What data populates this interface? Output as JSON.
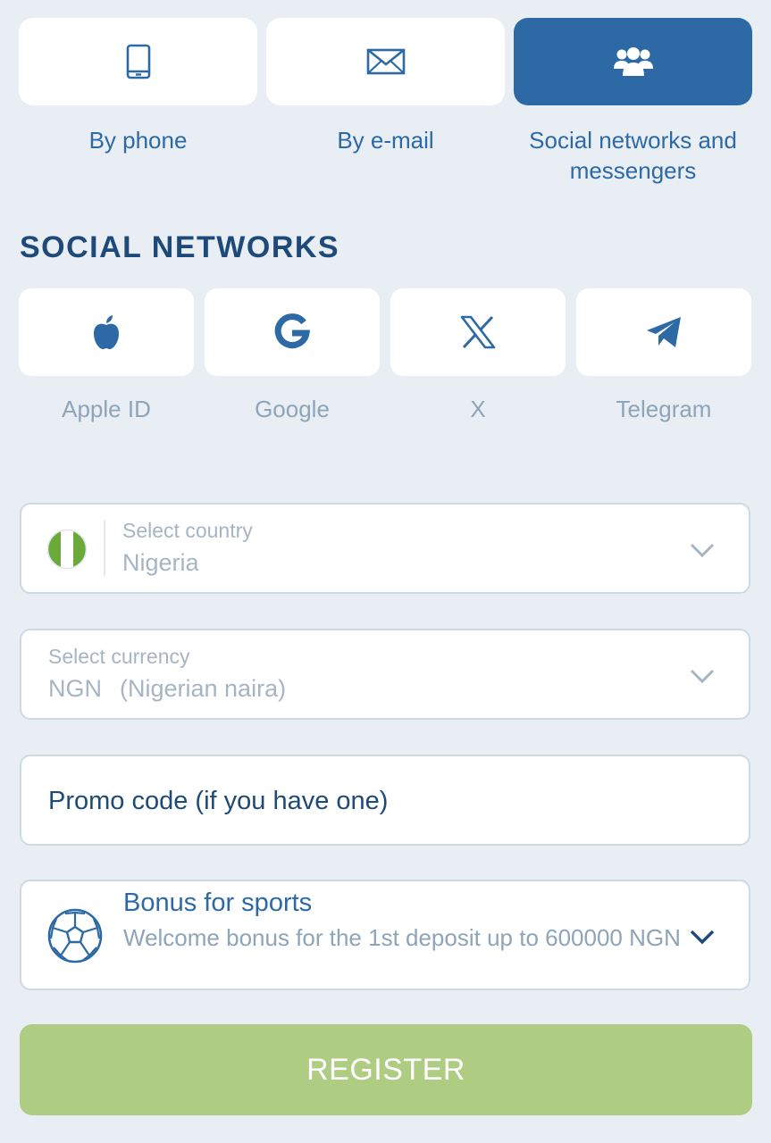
{
  "methods": [
    {
      "label": "By phone",
      "icon": "phone-icon"
    },
    {
      "label": "By e-mail",
      "icon": "envelope-icon"
    },
    {
      "label": "Social networks and messengers",
      "icon": "users-group-icon"
    }
  ],
  "social": {
    "title": "SOCIAL NETWORKS",
    "items": [
      {
        "label": "Apple ID",
        "icon": "apple-icon"
      },
      {
        "label": "Google",
        "icon": "google-icon"
      },
      {
        "label": "X",
        "icon": "x-icon"
      },
      {
        "label": "Telegram",
        "icon": "telegram-icon"
      }
    ]
  },
  "form": {
    "country": {
      "label": "Select country",
      "value": "Nigeria",
      "flag_icon": "nigeria-flag-icon"
    },
    "currency": {
      "label": "Select currency",
      "code": "NGN",
      "name": "(Nigerian naira)"
    },
    "promo": {
      "placeholder": "Promo code (if you have one)"
    },
    "bonus": {
      "title": "Bonus for sports",
      "description": "Welcome bonus for the 1st deposit up to 600000 NGN",
      "icon": "soccer-ball-icon"
    }
  },
  "register_label": "REGISTER",
  "colors": {
    "background": "#e9eef4",
    "primary": "#2d6aa5",
    "heading": "#1d4a78",
    "muted": "#a6b5c3",
    "register": "#aecd82",
    "flag_green": "#6aaa3a"
  }
}
